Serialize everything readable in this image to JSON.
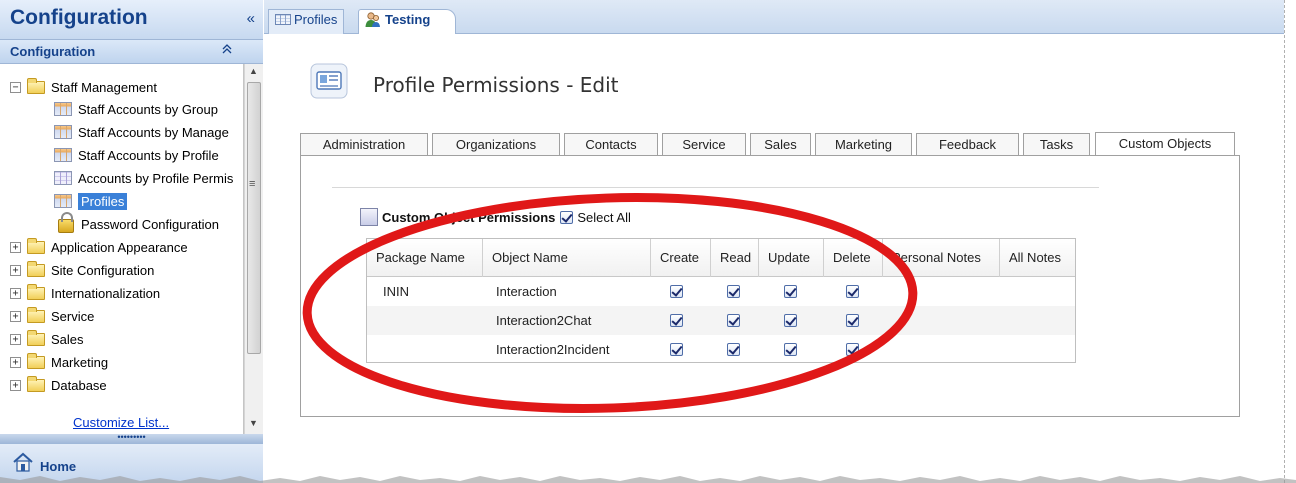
{
  "left_panel": {
    "title": "Configuration",
    "collapse_glyph": "«",
    "section_title": "Configuration",
    "section_collapse_glyph": "⌃",
    "tree": [
      {
        "label": "Staff Management",
        "expander": "−",
        "icon": "folder-icon"
      },
      {
        "label": "Staff Accounts by Group",
        "icon": "report-icon"
      },
      {
        "label": "Staff Accounts by Manage",
        "icon": "report-icon"
      },
      {
        "label": "Staff Accounts by Profile",
        "icon": "report-icon"
      },
      {
        "label": "Accounts by Profile Permis",
        "icon": "report-icon"
      },
      {
        "label": "Profiles",
        "icon": "report-icon",
        "selected": true
      },
      {
        "label": "Password Configuration",
        "icon": "lock-icon"
      },
      {
        "label": "Application Appearance",
        "expander": "+",
        "icon": "folder-icon"
      },
      {
        "label": "Site Configuration",
        "expander": "+",
        "icon": "folder-icon"
      },
      {
        "label": "Internationalization",
        "expander": "+",
        "icon": "folder-icon"
      },
      {
        "label": "Service",
        "expander": "+",
        "icon": "folder-icon"
      },
      {
        "label": "Sales",
        "expander": "+",
        "icon": "folder-icon"
      },
      {
        "label": "Marketing",
        "expander": "+",
        "icon": "folder-icon"
      },
      {
        "label": "Database",
        "expander": "+",
        "icon": "folder-icon"
      }
    ],
    "scroll_marker": "≡",
    "customize_link": "Customize List...",
    "splitter_dots": "•••••••••",
    "home_label": "Home"
  },
  "doc_tabs": [
    {
      "label": "Profiles",
      "icon": "grid-icon",
      "active": false
    },
    {
      "label": "Testing",
      "icon": "person-icon",
      "active": true
    }
  ],
  "page": {
    "title": "Profile Permissions - Edit",
    "perm_tabs": [
      "Administration",
      "Organizations",
      "Contacts",
      "Service",
      "Sales",
      "Marketing",
      "Feedback",
      "Tasks",
      "Custom Objects"
    ],
    "active_perm_tab": "Custom Objects",
    "section_title": "Custom Object Permissions",
    "select_all_label": "Select All",
    "select_all_checked": true
  },
  "grid": {
    "columns": [
      "Package Name",
      "Object Name",
      "Create",
      "Read",
      "Update",
      "Delete",
      "Personal Notes",
      "All Notes"
    ],
    "rows": [
      {
        "package": "ININ",
        "object": "Interaction",
        "create": true,
        "read": true,
        "update": true,
        "delete": true
      },
      {
        "package": "",
        "object": "Interaction2Chat",
        "create": true,
        "read": true,
        "update": true,
        "delete": true
      },
      {
        "package": "",
        "object": "Interaction2Incident",
        "create": true,
        "read": true,
        "update": true,
        "delete": true
      }
    ]
  },
  "annotation": {
    "color": "#e01818",
    "shape": "ellipse"
  },
  "colors": {
    "nav_text": "#15428b",
    "selected": "#3a80d8",
    "link": "#0033cc"
  }
}
